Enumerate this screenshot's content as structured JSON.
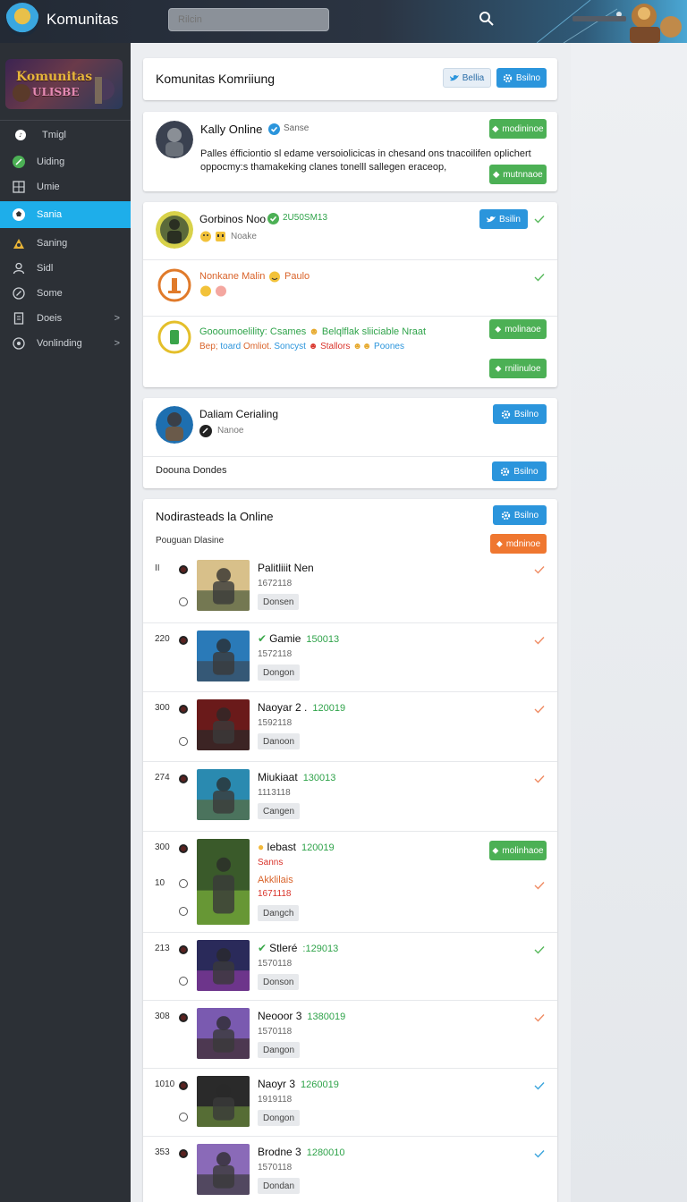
{
  "app": {
    "title": "Komunitas"
  },
  "search": {
    "placeholder": "Rilcin"
  },
  "sidebar": {
    "banner": {
      "line1": "Komunitas",
      "line2": "ULISBE"
    },
    "items": [
      {
        "label": "Tmigl",
        "icon": "music-note-icon"
      },
      {
        "label": "Uiding",
        "icon": "leaf-icon"
      },
      {
        "label": "Umie",
        "icon": "grid-icon"
      },
      {
        "label": "Sania",
        "icon": "soccer-ball-icon",
        "active": true
      },
      {
        "label": "Saning",
        "icon": "trophy-icon"
      },
      {
        "label": "Sidl",
        "icon": "user-icon"
      },
      {
        "label": "Some",
        "icon": "compass-icon"
      },
      {
        "label": "Doeis",
        "icon": "document-icon",
        "chevron": ">"
      },
      {
        "label": "Vonlinding",
        "icon": "gauge-icon",
        "chevron": ">"
      }
    ]
  },
  "header_panel": {
    "title": "Komunitas Komriiung",
    "btn1": "Bellia",
    "btn2": "Bsilno"
  },
  "post_panel": {
    "user": "Kally Online",
    "status": "Sanse",
    "body_line1": "Palles éfficiontio sl edame versoiolicicas in chesand ons tnacoilifen oplichert",
    "body_line2": "oppocmy:s thamakeking clanes tonelll sallegen eraceop,",
    "btn1": "modininoe",
    "btn2": "mutnnaoe"
  },
  "activity_panel": {
    "item1": {
      "name": "Gorbinos Noo",
      "score": "2U50SM13",
      "sub": "Noake",
      "btn": "Bsilin"
    },
    "item2": {
      "name": "Nonkane Malin",
      "extra": "Paulo"
    },
    "item3": {
      "line1": "Goooumoelility: Csames",
      "line1b": "Belqlflak",
      "line1c": "sliiciable Nraat",
      "line2a": "Bep;",
      "line2b": "toard",
      "line2c": "Omliot.",
      "line2d": "Soncyst",
      "line2e": "Stallors",
      "line2f": "Poones",
      "btn1": "molinaoe",
      "btn2": "rnilinuloe"
    }
  },
  "profile_panel": {
    "name": "Daliam Cerialing",
    "sub": "Nanoe",
    "btn1": "Bsilno",
    "footer": "Doouna Dondes",
    "btn2": "Bsilno"
  },
  "list_panel": {
    "title": "Nodirasteads la Online",
    "subtitle": "Pouguan Dlasine",
    "btn_blue": "Bsilno",
    "btn_orange": "mdninoe",
    "rows": [
      {
        "rank": "II",
        "name": "Palitliiit Nen",
        "score": "",
        "sub": "1672118",
        "tag": "Donsen",
        "check_color": "#ef8b63"
      },
      {
        "rank": "220",
        "name": "Gamie",
        "score": "150013",
        "sub": "1572118",
        "tag": "Dongon",
        "check_color": "#ef8b63"
      },
      {
        "rank": "300",
        "name": "Naoyar 2 .",
        "score": "120019",
        "sub": "1592118",
        "tag": "Danoon",
        "check_color": "#ef8b63"
      },
      {
        "rank": "274",
        "name": "Miukiaat",
        "score": "130013",
        "sub": "1113118",
        "tag": "Cangen",
        "check_color": "#ef8b63"
      },
      {
        "rank": "300",
        "rank2": "10",
        "name": "Iebast",
        "score": "120019",
        "sub": "Sanns",
        "sub2": "Akklilais",
        "sub3": "1671118",
        "tag": "Dangch",
        "btn": "molinhaoe",
        "check_color": "#ef8b63"
      },
      {
        "rank": "213",
        "name": "Stleré",
        "score": ":129013",
        "sub": "1570118",
        "tag": "Donson",
        "check_color": "#58b95c"
      },
      {
        "rank": "308",
        "name": "Neooor 3",
        "score": "1380019",
        "sub": "1570118",
        "tag": "Dangon",
        "check_color": "#ef8b63"
      },
      {
        "rank": "1010",
        "name": "Naoyr 3",
        "score": "1260019",
        "sub": "1919118",
        "tag": "Dongon",
        "check_color": "#3aa4dc"
      },
      {
        "rank": "353",
        "name": "Brodne 3",
        "score": "1280010",
        "sub": "1570118",
        "tag": "Dondan",
        "check_color": "#3aa4dc"
      }
    ]
  },
  "colors": {
    "accent": "#1eaeea",
    "green": "#4cb055",
    "blue": "#2b95dc",
    "orange": "#ef7730",
    "sidebar_bg": "#2c3036"
  }
}
